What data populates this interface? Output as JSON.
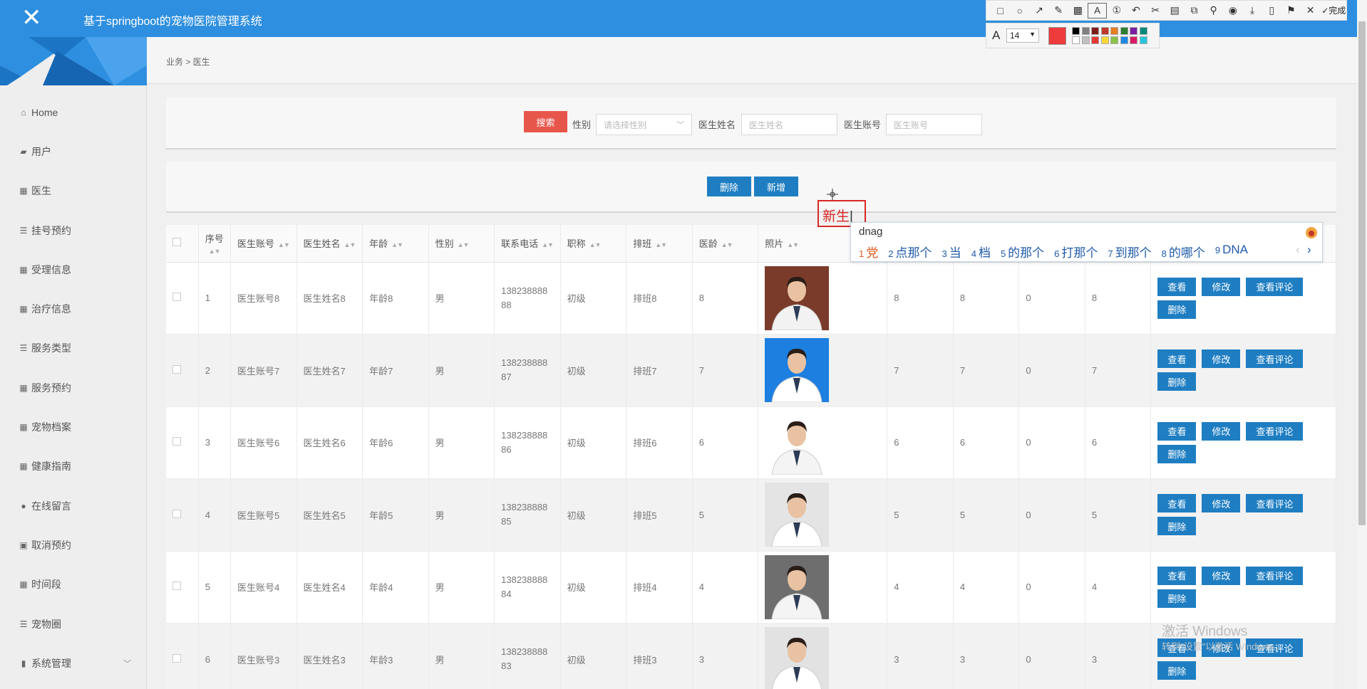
{
  "app": {
    "title": "基于springboot的宠物医院管理系统",
    "close_glyph": "✕"
  },
  "sidebar": {
    "items": [
      {
        "icon": "home-icon",
        "glyph": "⌂",
        "label": "Home"
      },
      {
        "icon": "ticket-icon",
        "glyph": "▰",
        "label": "用户"
      },
      {
        "icon": "grid-icon",
        "glyph": "▦",
        "label": "医生"
      },
      {
        "icon": "list-icon",
        "glyph": "☰",
        "label": "挂号预约"
      },
      {
        "icon": "grid-icon",
        "glyph": "▦",
        "label": "受理信息"
      },
      {
        "icon": "grid-icon",
        "glyph": "▦",
        "label": "治疗信息"
      },
      {
        "icon": "list-icon",
        "glyph": "☰",
        "label": "服务类型"
      },
      {
        "icon": "grid-icon",
        "glyph": "▦",
        "label": "服务预约"
      },
      {
        "icon": "grid-icon",
        "glyph": "▦",
        "label": "宠物档案"
      },
      {
        "icon": "grid-icon",
        "glyph": "▦",
        "label": "健康指南"
      },
      {
        "icon": "location-icon",
        "glyph": "●",
        "label": "在线留言"
      },
      {
        "icon": "clipboard-icon",
        "glyph": "▣",
        "label": "取消预约"
      },
      {
        "icon": "grid-icon",
        "glyph": "▦",
        "label": "时间段"
      },
      {
        "icon": "list-icon",
        "glyph": "☰",
        "label": "宠物圈"
      },
      {
        "icon": "chart-icon",
        "glyph": "▮",
        "label": "系统管理",
        "chevron": "﹀"
      }
    ]
  },
  "breadcrumb": "业务 > 医生",
  "search": {
    "search_label": "搜索",
    "gender_label": "性别",
    "gender_placeholder": "请选择性别",
    "name_label": "医生姓名",
    "name_placeholder": "医生姓名",
    "account_label": "医生账号",
    "account_placeholder": "医生账号"
  },
  "actions": {
    "delete_label": "删除",
    "add_label": "新增"
  },
  "table": {
    "headers": [
      "序号",
      "医生账号",
      "医生姓名",
      "年龄",
      "性别",
      "联系电话",
      "职称",
      "排班",
      "医龄",
      "照片"
    ],
    "rows": [
      {
        "idx": "1",
        "account": "医生账号8",
        "name": "医生姓名8",
        "age": "年龄8",
        "gender": "男",
        "phone1": "138238888",
        "phone2": "88",
        "title": "初级",
        "shift": "排班8",
        "years": "8",
        "c1": "8",
        "c2": "8",
        "c3": "0",
        "c4": "8",
        "photo_bg": "#7a3b2a",
        "photo_coat": "#f2f2f2"
      },
      {
        "idx": "2",
        "account": "医生账号7",
        "name": "医生姓名7",
        "age": "年龄7",
        "gender": "男",
        "phone1": "138238888",
        "phone2": "87",
        "title": "初级",
        "shift": "排班7",
        "years": "7",
        "c1": "7",
        "c2": "7",
        "c3": "0",
        "c4": "7",
        "photo_bg": "#1d7fe0",
        "photo_coat": "#ffffff"
      },
      {
        "idx": "3",
        "account": "医生账号6",
        "name": "医生姓名6",
        "age": "年龄6",
        "gender": "男",
        "phone1": "138238888",
        "phone2": "86",
        "title": "初级",
        "shift": "排班6",
        "years": "6",
        "c1": "6",
        "c2": "6",
        "c3": "0",
        "c4": "6",
        "photo_bg": "#ffffff",
        "photo_coat": "#f4f4f4"
      },
      {
        "idx": "4",
        "account": "医生账号5",
        "name": "医生姓名5",
        "age": "年龄5",
        "gender": "男",
        "phone1": "138238888",
        "phone2": "85",
        "title": "初级",
        "shift": "排班5",
        "years": "5",
        "c1": "5",
        "c2": "5",
        "c3": "0",
        "c4": "5",
        "photo_bg": "#e4e4e4",
        "photo_coat": "#ffffff"
      },
      {
        "idx": "5",
        "account": "医生账号4",
        "name": "医生姓名4",
        "age": "年龄4",
        "gender": "男",
        "phone1": "138238888",
        "phone2": "84",
        "title": "初级",
        "shift": "排班4",
        "years": "4",
        "c1": "4",
        "c2": "4",
        "c3": "0",
        "c4": "4",
        "photo_bg": "#6e6e6e",
        "photo_coat": "#f4f4f4"
      },
      {
        "idx": "6",
        "account": "医生账号3",
        "name": "医生姓名3",
        "age": "年龄3",
        "gender": "男",
        "phone1": "138238888",
        "phone2": "83",
        "title": "初级",
        "shift": "排班3",
        "years": "3",
        "c1": "3",
        "c2": "3",
        "c3": "0",
        "c4": "3",
        "photo_bg": "#e2e2e2",
        "photo_coat": "#ffffff"
      }
    ],
    "row_actions": {
      "view": "查看",
      "edit": "修改",
      "review": "查看评论",
      "delete": "删除"
    }
  },
  "screenshot_tool": {
    "done_label": "完成",
    "font_size": "14",
    "font_glyph": "A",
    "current_color": "#ee3b3b",
    "palette": [
      "#000000",
      "#7f7f7f",
      "#7f1d1d",
      "#c0392b",
      "#e67e22",
      "#2e7d32",
      "#7b1fa2",
      "#00897b",
      "#ffffff",
      "#c0c0c0",
      "#e53935",
      "#fdd835",
      "#8bc34a",
      "#1e88e5",
      "#d81b60",
      "#26c6da"
    ]
  },
  "annotation": {
    "text": "新生"
  },
  "ime": {
    "input": "dnag",
    "candidates": [
      {
        "n": "1",
        "t": "党"
      },
      {
        "n": "2",
        "t": "点那个"
      },
      {
        "n": "3",
        "t": "当"
      },
      {
        "n": "4",
        "t": "档"
      },
      {
        "n": "5",
        "t": "的那个"
      },
      {
        "n": "6",
        "t": "打那个"
      },
      {
        "n": "7",
        "t": "到那个"
      },
      {
        "n": "8",
        "t": "的哪个"
      },
      {
        "n": "9",
        "t": "DNA"
      }
    ],
    "next_glyph": "›",
    "prev_glyph": "‹"
  },
  "watermark": {
    "line1": "激活 Windows",
    "line2": "转到\"设置\"以激活 Windows。"
  },
  "colors": {
    "header": "#2e8fe0",
    "btn_blue": "#1f7ec2",
    "btn_red": "#e7564b"
  }
}
